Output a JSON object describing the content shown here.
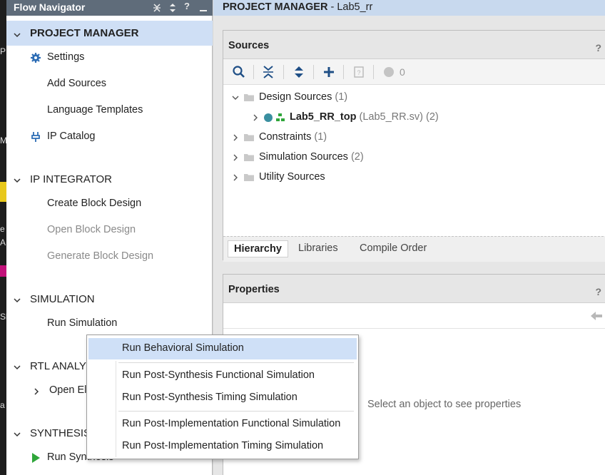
{
  "flow_navigator": {
    "title": "Flow Navigator",
    "title_buttons": [
      "collapse-all-icon",
      "expand-all-icon",
      "help-icon",
      "minimize-icon"
    ],
    "help_glyph": "?",
    "sections": [
      {
        "label": "PROJECT MANAGER",
        "items": [
          "Settings",
          "Add Sources",
          "Language Templates",
          "IP Catalog"
        ]
      },
      {
        "label": "IP INTEGRATOR",
        "items": [
          "Create Block Design",
          "Open Block Design",
          "Generate Block Design"
        ]
      },
      {
        "label": "SIMULATION",
        "items": [
          "Run Simulation"
        ]
      },
      {
        "label": "RTL ANALYS",
        "items": [
          "Open El"
        ]
      },
      {
        "label": "SYNTHESIS",
        "items": [
          "Run Synthesis"
        ]
      }
    ]
  },
  "desktop_fragments": [
    "P",
    "M",
    "e",
    "A",
    "Sh",
    "a"
  ],
  "main": {
    "header_bold": "PROJECT MANAGER",
    "header_rest": " - Lab5_rr"
  },
  "sources": {
    "title": "Sources",
    "help": "?",
    "toolbar": {
      "icons": [
        "search-icon",
        "collapse-all-icon",
        "expand-all-icon",
        "add-icon",
        "properties-icon",
        "status-circle-icon"
      ],
      "count": "0"
    },
    "tree": [
      {
        "label": "Design Sources",
        "count": "(1)"
      },
      {
        "label": "Lab5_RR_top",
        "detail": "(Lab5_RR.sv)",
        "count": "(2)"
      },
      {
        "label": "Constraints",
        "count": "(1)"
      },
      {
        "label": "Simulation Sources",
        "count": "(2)"
      },
      {
        "label": "Utility Sources",
        "count": ""
      }
    ],
    "tabs": [
      "Hierarchy",
      "Libraries",
      "Compile Order"
    ]
  },
  "properties": {
    "title": "Properties",
    "help": "?",
    "back_icon": "back-arrow-icon",
    "empty_text": "Select an object to see properties"
  },
  "context_menu": {
    "items": [
      "Run Behavioral Simulation",
      "Run Post-Synthesis Functional Simulation",
      "Run Post-Synthesis Timing Simulation",
      "Run Post-Implementation Functional Simulation",
      "Run Post-Implementation Timing Simulation"
    ]
  },
  "colors": {
    "title_bar": "#5f6c7a",
    "selection": "#cfdff5",
    "menu_highlight": "#cfe0f7",
    "run_green": "#2fa63a",
    "status_teal": "#3a8fa0"
  }
}
